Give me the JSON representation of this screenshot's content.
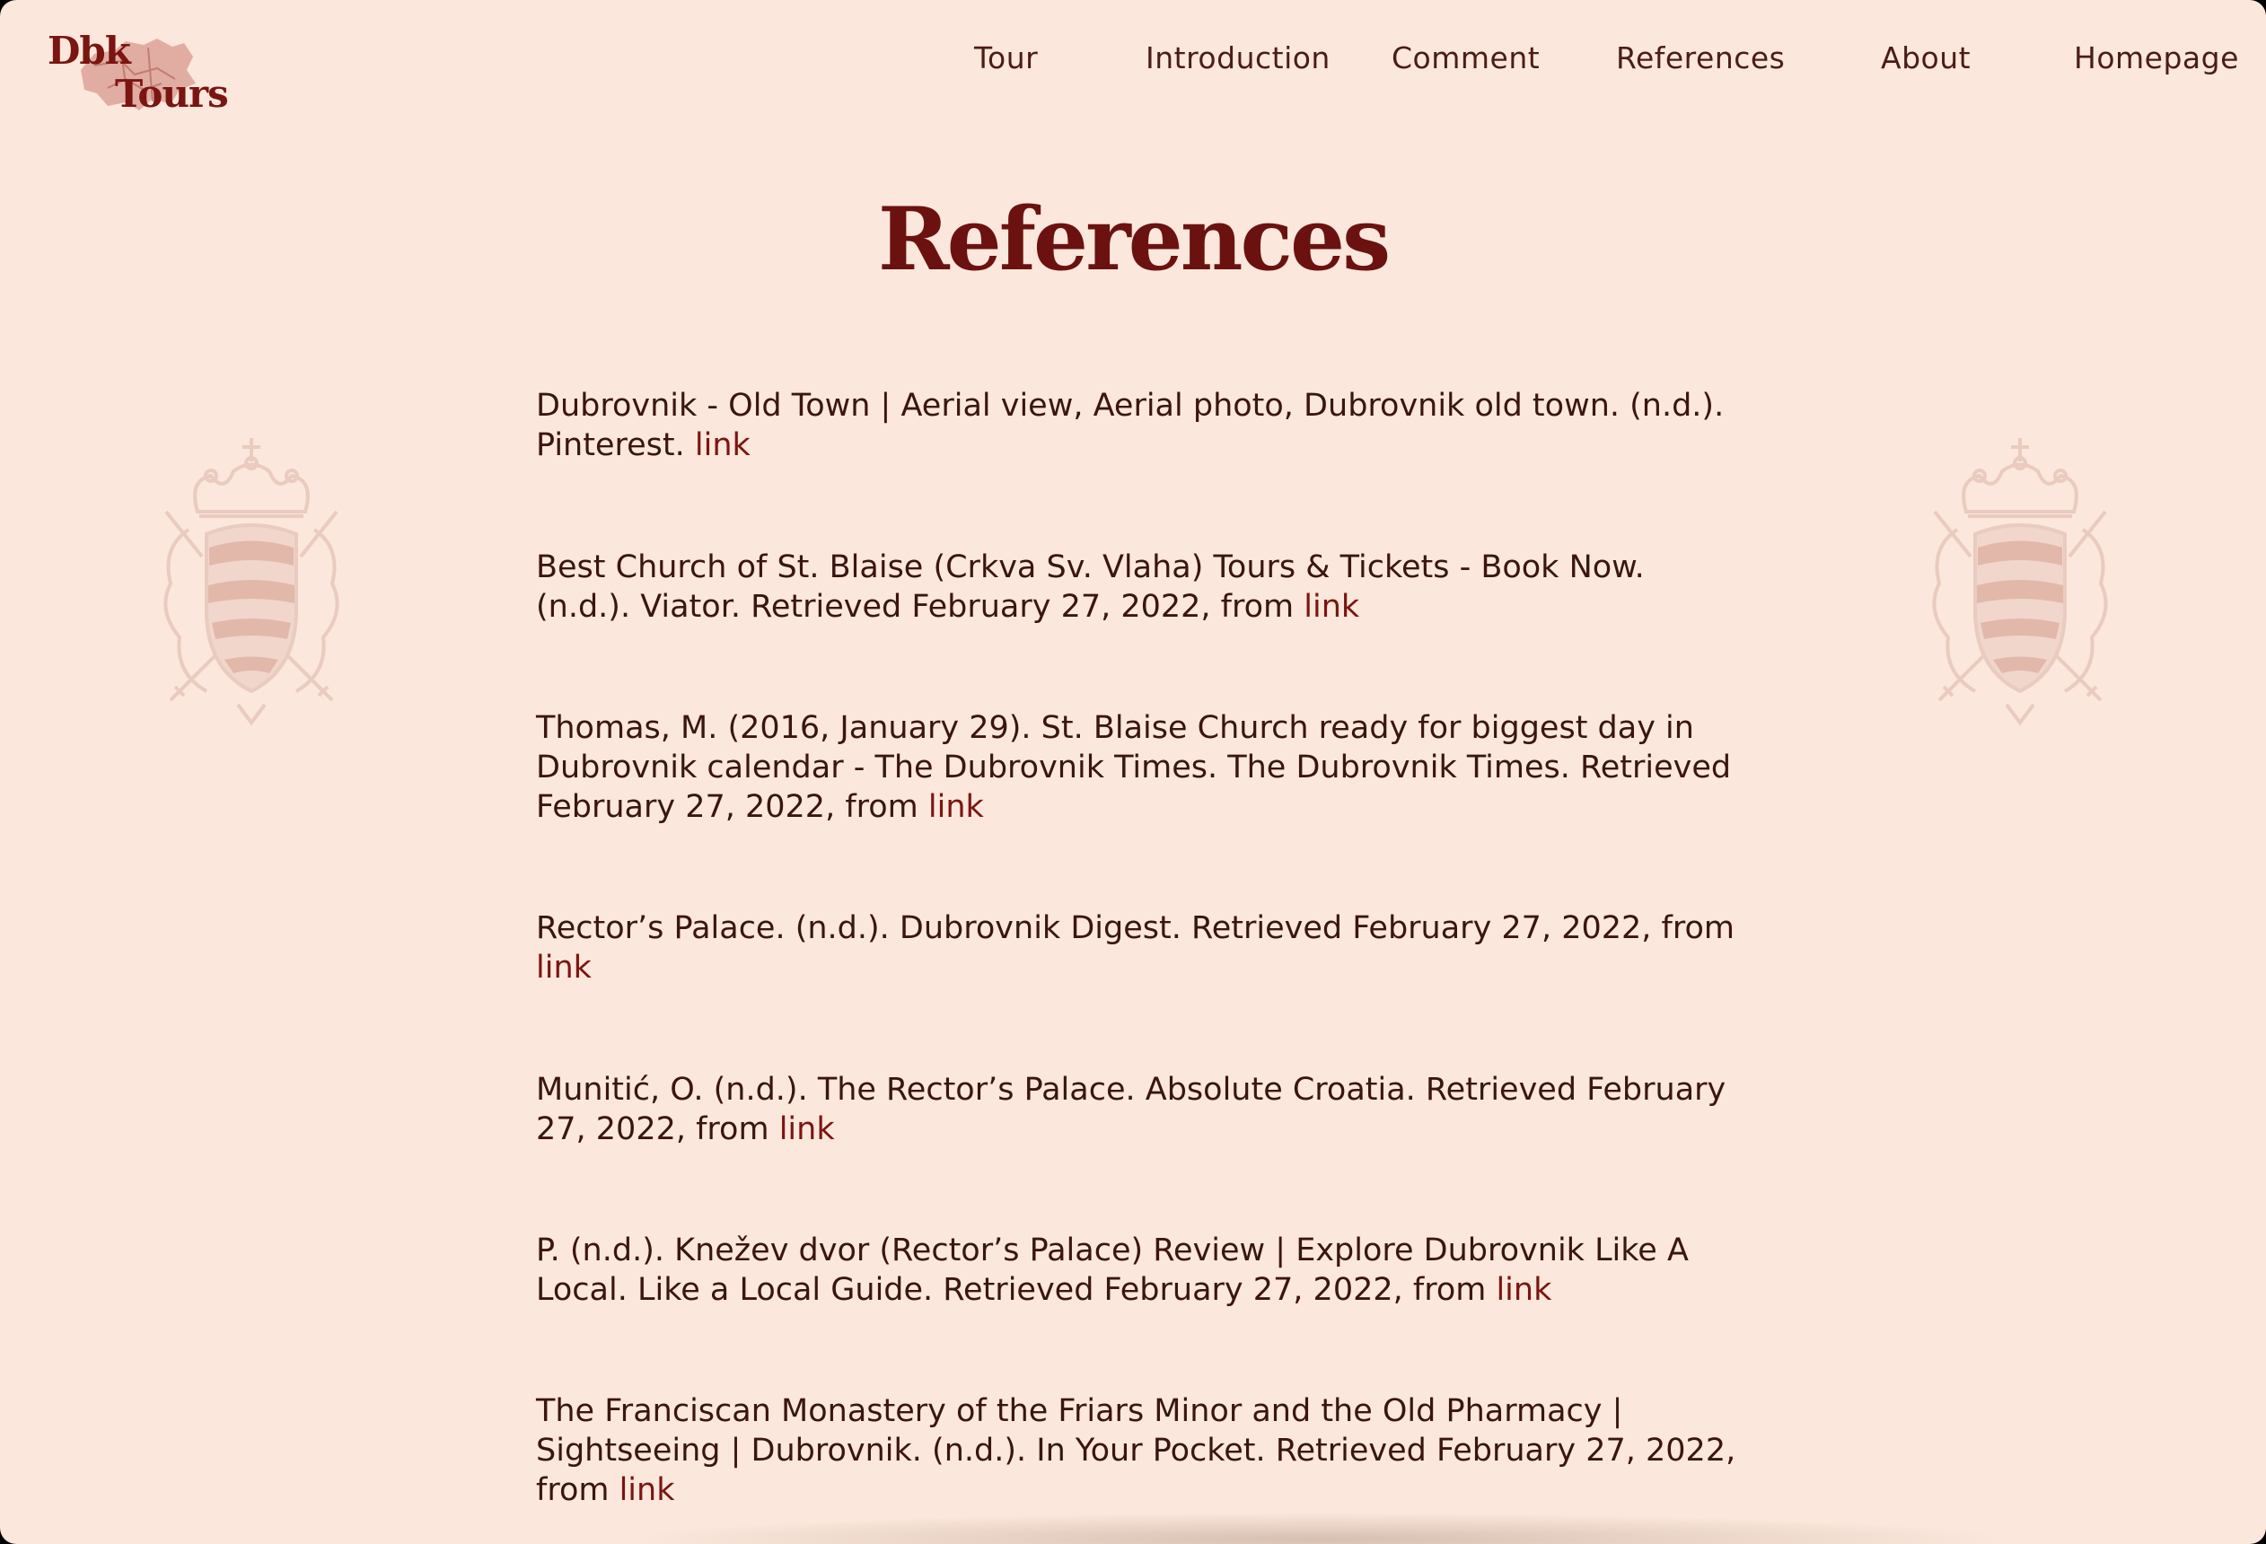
{
  "logo": {
    "line1": "Dbk",
    "line2": "Tours"
  },
  "nav": {
    "items": [
      {
        "label": "Tour"
      },
      {
        "label": "Introduction"
      },
      {
        "label": "Comment"
      },
      {
        "label": "References"
      },
      {
        "label": "About"
      },
      {
        "label": "Homepage"
      }
    ]
  },
  "page": {
    "title": "References"
  },
  "references": [
    {
      "text": "Dubrovnik - Old Town | Aerial view, Aerial photo, Dubrovnik old town. (n.d.). Pinterest. ",
      "link": "link"
    },
    {
      "text": "Best Church of St. Blaise (Crkva Sv. Vlaha) Tours & Tickets - Book Now. (n.d.). Viator. Retrieved February 27, 2022, from ",
      "link": "link"
    },
    {
      "text": "Thomas, M. (2016, January 29). St. Blaise Church ready for biggest day in Dubrovnik calendar - The Dubrovnik Times. The Dubrovnik Times. Retrieved February 27, 2022, from ",
      "link": "link"
    },
    {
      "text": "Rector’s Palace. (n.d.). Dubrovnik Digest. Retrieved February 27, 2022, from ",
      "link": "link"
    },
    {
      "text": "Munitić, O. (n.d.). The Rector’s Palace. Absolute Croatia. Retrieved February 27, 2022, from ",
      "link": "link"
    },
    {
      "text": "P. (n.d.). Knežev dvor (Rector’s Palace) Review | Explore Dubrovnik Like A Local. Like a Local Guide. Retrieved February 27, 2022, from ",
      "link": "link"
    },
    {
      "text": "The Franciscan Monastery of the Friars Minor and the Old Pharmacy | Sightseeing | Dubrovnik. (n.d.). In Your Pocket. Retrieved February 27, 2022, from ",
      "link": "link"
    }
  ],
  "colors": {
    "background": "#fbe7db",
    "title": "#6b1210",
    "text": "#3a1512",
    "link": "#7a1512",
    "crest": "#e7c6b8"
  },
  "icons": {
    "logo": "dubrovnik-map-logo",
    "crest": "coat-of-arms-crest"
  }
}
